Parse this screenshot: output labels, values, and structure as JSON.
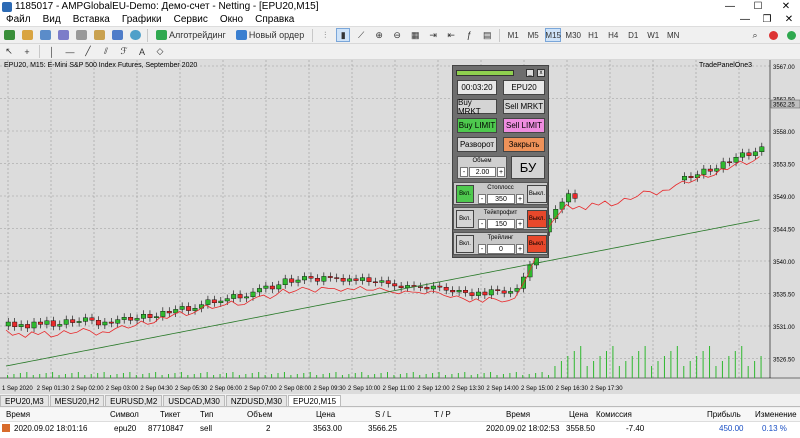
{
  "window": {
    "title": "1185017 - AMPGlobalEU-Demo: Демо-счет - Netting - [EPU20,M15]"
  },
  "menu": {
    "items": [
      "Файл",
      "Вид",
      "Вставка",
      "Графики",
      "Сервис",
      "Окно",
      "Справка"
    ]
  },
  "toolbar": {
    "algo_label": "Алготрейдинг",
    "new_order_label": "Новый ордер",
    "timeframes": [
      "M1",
      "M5",
      "M15",
      "M30",
      "H1",
      "H4",
      "D1",
      "W1",
      "MN"
    ],
    "active_timeframe": "M15"
  },
  "chart": {
    "symbol_line": "EPU20, M15:  E-Mini S&P 500 Index Futures, September 2020",
    "tradepanel_label": "TradePanelOne3",
    "price_labels": [
      "3567.00",
      "3562.50",
      "3558.00",
      "3553.50",
      "3549.00",
      "3544.50",
      "3540.00",
      "3535.50",
      "3531.00",
      "3526.50"
    ],
    "current_price": "3562.25",
    "time_labels": [
      "1 Sep 2020",
      "2 Sep 01:30",
      "2 Sep 02:00",
      "2 Sep 03:00",
      "2 Sep 04:30",
      "2 Sep 05:30",
      "2 Sep 06:00",
      "2 Sep 07:00",
      "2 Sep 08:00",
      "2 Sep 09:30",
      "2 Sep 10:00",
      "2 Sep 11:00",
      "2 Sep 12:00",
      "2 Sep 13:30",
      "2 Sep 14:00",
      "2 Sep 15:00",
      "2 Sep 16:30",
      "2 Sep 17:30"
    ],
    "colors": {
      "bull": "#2fb82f",
      "bear": "#e8292b",
      "ma_fast": "#e8292b",
      "ma_slow": "#2a7a2a",
      "background": "#dcdcdc",
      "grid": "#9a9a9a"
    }
  },
  "trade_panel": {
    "time": "00:03:20",
    "symbol": "EPU20",
    "buy_market": "Buy MRKT",
    "sell_market": "Sell MRKT",
    "buy_limit": "Buy LIMIT",
    "sell_limit": "Sell LIMIT",
    "reverse": "Разворот",
    "close": "Закрыть",
    "volume_label": "Объем",
    "volume_value": "2.00",
    "bu_label": "БУ",
    "stoploss_label": "Стоплосс",
    "stoploss_value": "350",
    "takeprofit_label": "Тейкпрофит",
    "takeprofit_value": "150",
    "trailing_label": "Трейлинг",
    "trailing_value": "0",
    "on_label": "Вкл.",
    "off_label": "Выкл.",
    "minus": "-",
    "plus": "+"
  },
  "symbol_tabs": [
    "EPU20,M3",
    "MESU20,H2",
    "EURUSD,M2",
    "USDCAD,M30",
    "NZDUSD,M30",
    "EPU20,M15"
  ],
  "active_tab": "EPU20,M15",
  "trades": {
    "columns": [
      "Время",
      "Символ",
      "Тикет",
      "Тип",
      "Объем",
      "Цена",
      "S / L",
      "T / P",
      "Время",
      "Цена",
      "Комиссия",
      "Прибыль",
      "Изменение"
    ],
    "rows": [
      [
        "2020.09.02 18:01:16",
        "epu20",
        "87710847",
        "sell",
        "2",
        "3563.00",
        "3566.25",
        "",
        "2020.09.02 18:02:53",
        "3558.50",
        "-7.40",
        "450.00",
        "0.13 %"
      ]
    ]
  }
}
